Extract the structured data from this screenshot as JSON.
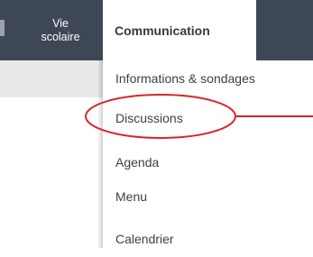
{
  "nav": {
    "vie_scolaire_line1": "Vie",
    "vie_scolaire_line2": "scolaire",
    "communication": "Communication"
  },
  "dropdown": {
    "items": [
      {
        "label": "Informations & sondages"
      },
      {
        "label": "Discussions"
      },
      {
        "label": "Agenda"
      },
      {
        "label": "Menu"
      },
      {
        "label": "Calendrier"
      }
    ]
  },
  "colors": {
    "nav_background": "#3d4756",
    "annotation": "#d7262a"
  }
}
